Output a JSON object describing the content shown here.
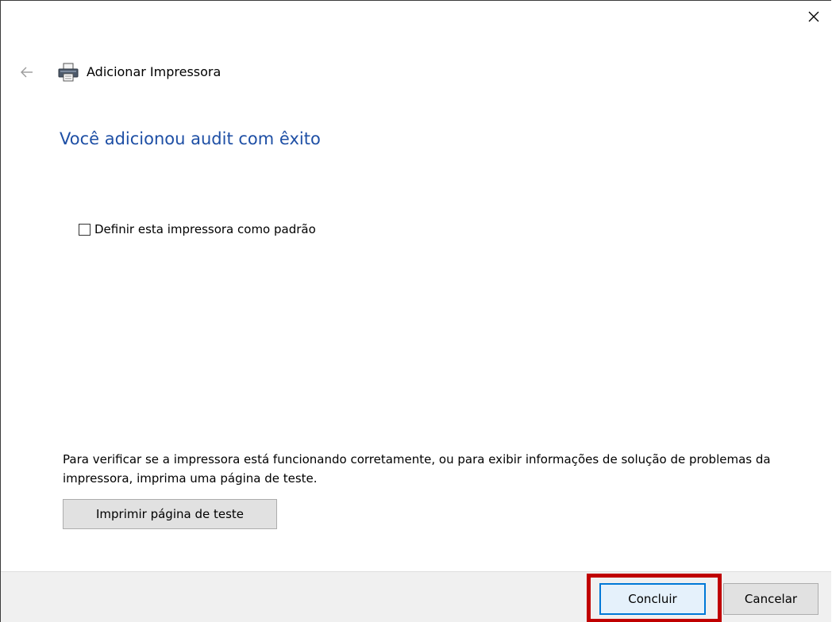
{
  "window": {
    "close_icon": "close-icon"
  },
  "header": {
    "back_icon": "back-arrow-icon",
    "printer_icon": "printer-icon",
    "title": "Adicionar Impressora"
  },
  "main": {
    "heading": "Você adicionou audit com êxito",
    "default_checkbox": {
      "label": "Definir esta impressora como padrão",
      "checked": false
    },
    "info_text": "Para verificar se a impressora está funcionando corretamente, ou para exibir informações de solução de problemas da impressora, imprima uma página de teste.",
    "test_page_button": "Imprimir página de teste"
  },
  "footer": {
    "finish_button": "Concluir",
    "cancel_button": "Cancelar"
  },
  "colors": {
    "heading": "#1e4fa5",
    "highlight": "#c00000",
    "default_button_border": "#0078d7",
    "footer_bg": "#f0f0f0"
  }
}
